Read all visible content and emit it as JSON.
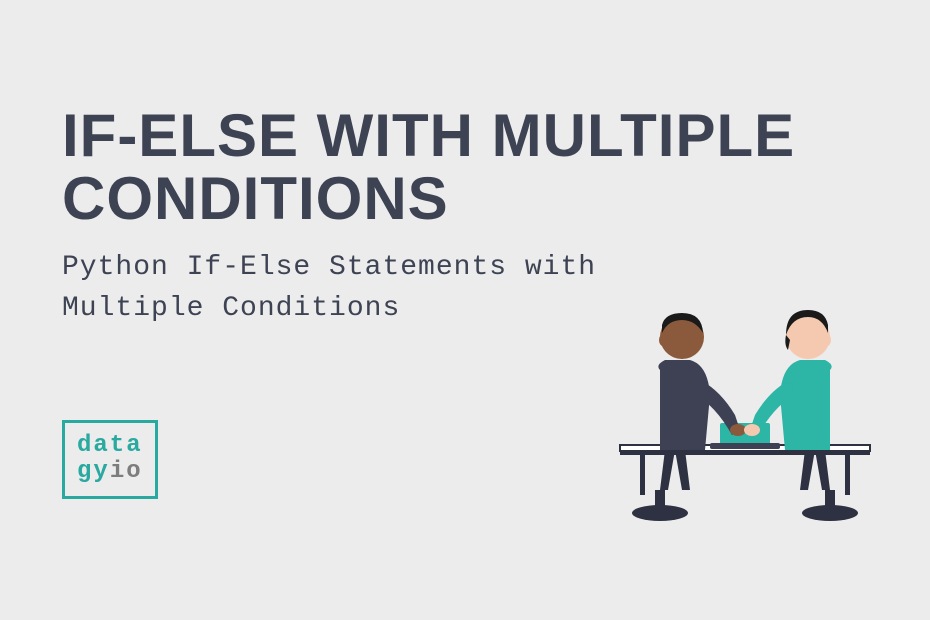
{
  "title": "IF-ELSE WITH MULTIPLE CONDITIONS",
  "subtitle_line1": "Python If-Else Statements with",
  "subtitle_line2": "Multiple Conditions",
  "logo": {
    "line1": "data",
    "line2_part1": "gy",
    "line2_part2": "io"
  },
  "colors": {
    "background": "#ececec",
    "text_dark": "#3d4353",
    "accent_teal": "#2aa9a0",
    "gray": "#7d7d7d",
    "skin1": "#8b5a3c",
    "skin2": "#f5c9b0",
    "shirt1": "#3d4153",
    "shirt2": "#2db5a5",
    "pants": "#2d3142"
  }
}
